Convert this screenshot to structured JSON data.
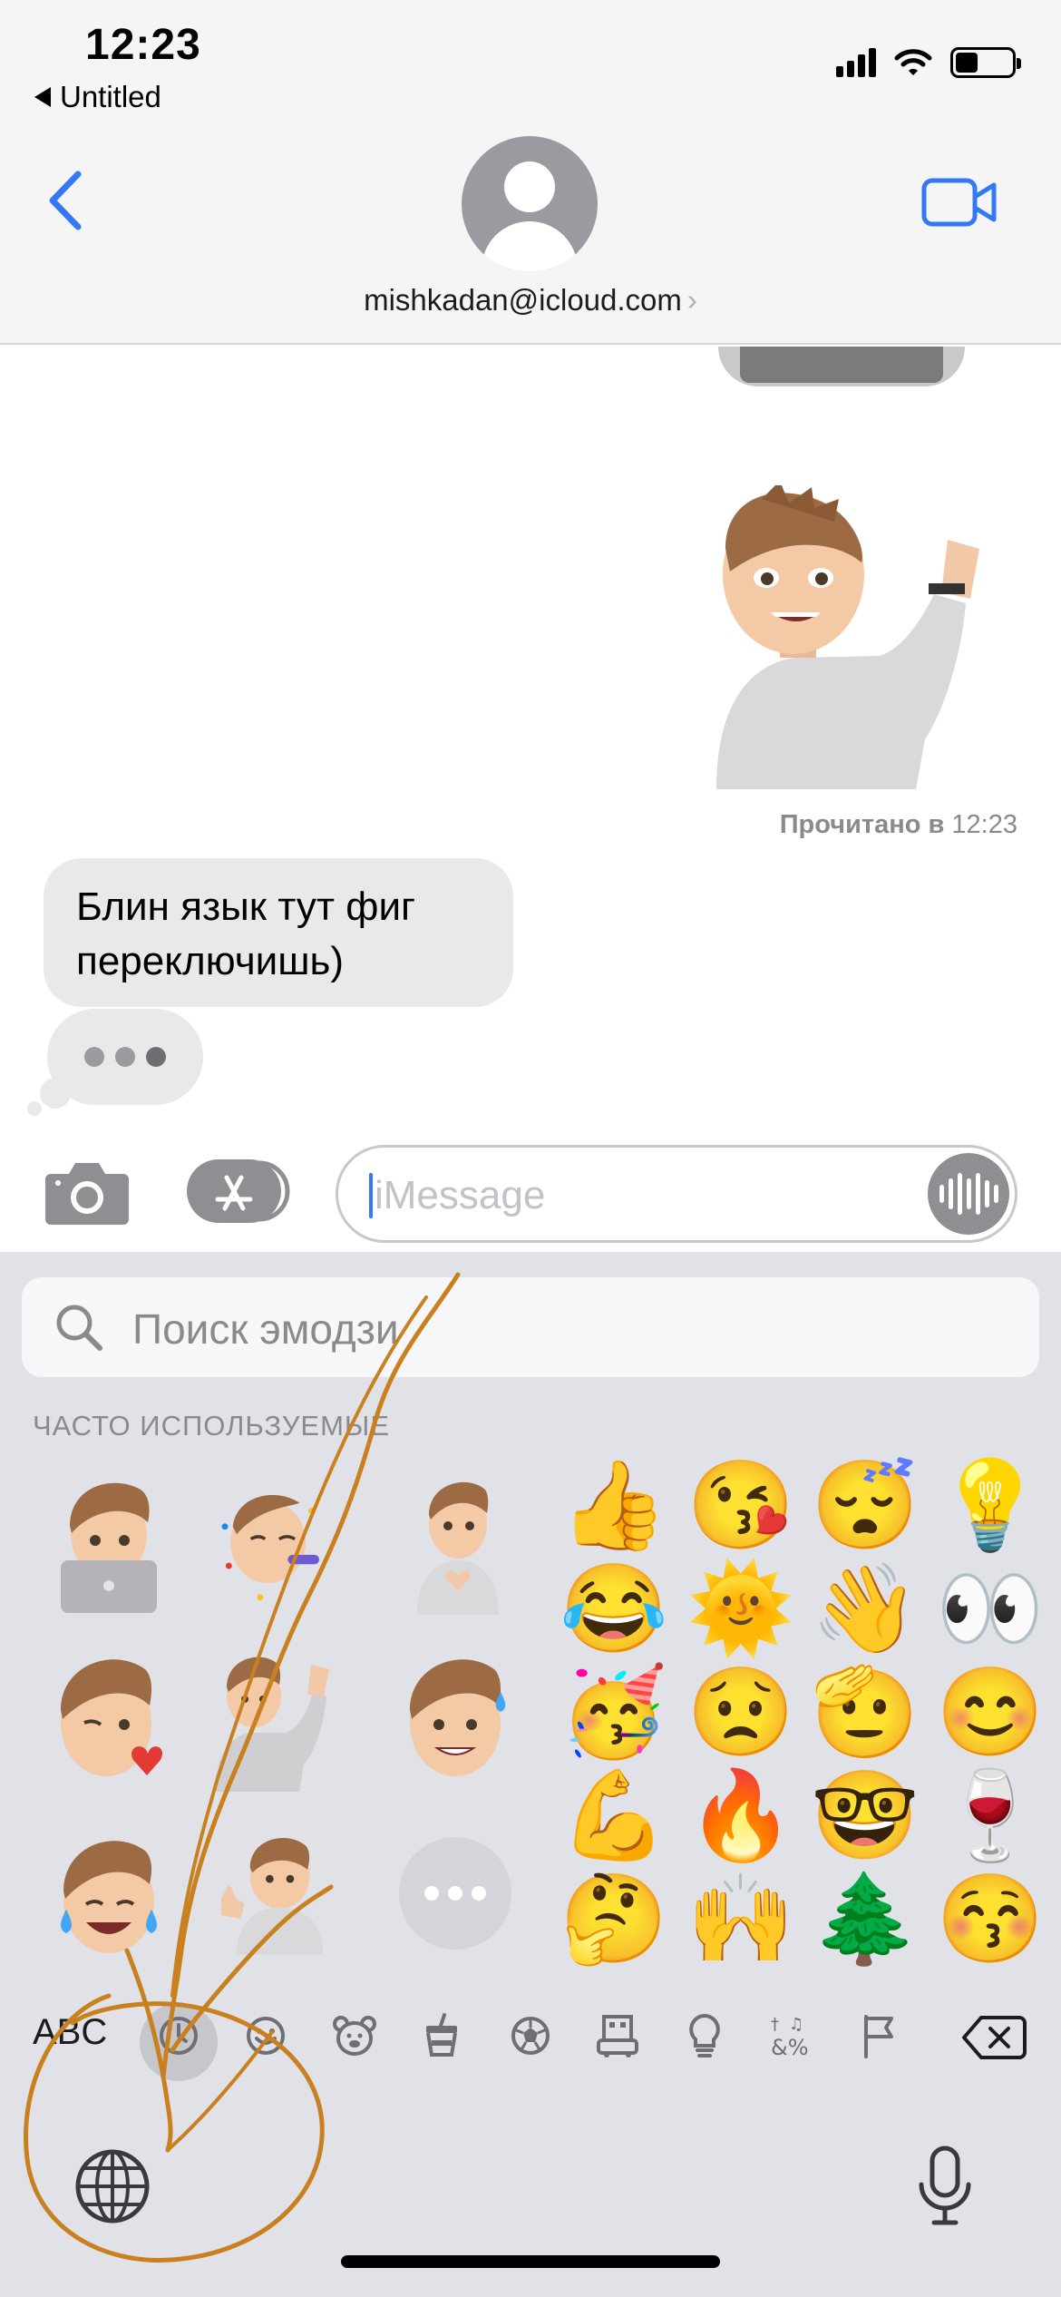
{
  "status_bar": {
    "time": "12:23",
    "back_app_label": "Untitled"
  },
  "header": {
    "contact_name": "mishkadan@icloud.com",
    "contact_chevron": "›",
    "back_icon": "chevron-left-icon",
    "video_icon": "video-camera-icon"
  },
  "conversation": {
    "read_receipt_label": "Прочитано в",
    "read_receipt_time": "12:23",
    "incoming_message": "Блин язык тут фиг переключишь)"
  },
  "compose": {
    "placeholder": "iMessage"
  },
  "emoji_keyboard": {
    "search_placeholder": "Поиск эмодзи",
    "section_title": "ЧАСТО ИСПОЛЬЗУЕМЫЕ",
    "emojis": [
      "👍",
      "😘",
      "😴",
      "💡",
      "😂",
      "🌞",
      "👋",
      "👀",
      "🥳",
      "😟",
      "🫡",
      "😊",
      "💪",
      "🔥",
      "🤓",
      "🍷",
      "🤔",
      "🙌",
      "🌲",
      "😚"
    ],
    "abc_label": "ABC",
    "categories": [
      "clock-icon",
      "smiley-icon",
      "bear-icon",
      "food-icon",
      "ball-icon",
      "building-icon",
      "lightbulb-icon",
      "symbols-icon",
      "flag-icon"
    ],
    "symbols_label": "&%"
  },
  "colors": {
    "accent": "#3478f6",
    "annotation": "#c9801f"
  }
}
